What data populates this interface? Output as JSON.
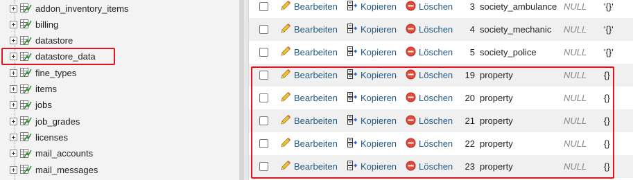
{
  "sidebar": {
    "items": [
      {
        "label": "addon_inventory_items"
      },
      {
        "label": "billing"
      },
      {
        "label": "datastore"
      },
      {
        "label": "datastore_data",
        "highlighted": true
      },
      {
        "label": "fine_types"
      },
      {
        "label": "items"
      },
      {
        "label": "jobs"
      },
      {
        "label": "job_grades"
      },
      {
        "label": "licenses"
      },
      {
        "label": "mail_accounts"
      },
      {
        "label": "mail_messages"
      }
    ]
  },
  "grid": {
    "actions": {
      "edit": "Bearbeiten",
      "copy": "Kopieren",
      "delete": "Löschen"
    },
    "rows": [
      {
        "id": "3",
        "name": "society_ambulance",
        "owner": "NULL",
        "data": "'{}'"
      },
      {
        "id": "4",
        "name": "society_mechanic",
        "owner": "NULL",
        "data": "'{}'"
      },
      {
        "id": "5",
        "name": "society_police",
        "owner": "NULL",
        "data": "'{}'"
      },
      {
        "id": "19",
        "name": "property",
        "owner": "NULL",
        "data": "{}"
      },
      {
        "id": "20",
        "name": "property",
        "owner": "NULL",
        "data": "{}"
      },
      {
        "id": "21",
        "name": "property",
        "owner": "NULL",
        "data": "{}"
      },
      {
        "id": "22",
        "name": "property",
        "owner": "NULL",
        "data": "{}"
      },
      {
        "id": "23",
        "name": "property",
        "owner": "NULL",
        "data": "{}"
      }
    ]
  },
  "colors": {
    "highlight": "#e0141e",
    "link": "#235a81",
    "null": "#8a8a8a"
  },
  "icons": {
    "edit": "pencil-icon",
    "copy": "copy-icon",
    "delete": "delete-icon",
    "table": "table-icon"
  }
}
